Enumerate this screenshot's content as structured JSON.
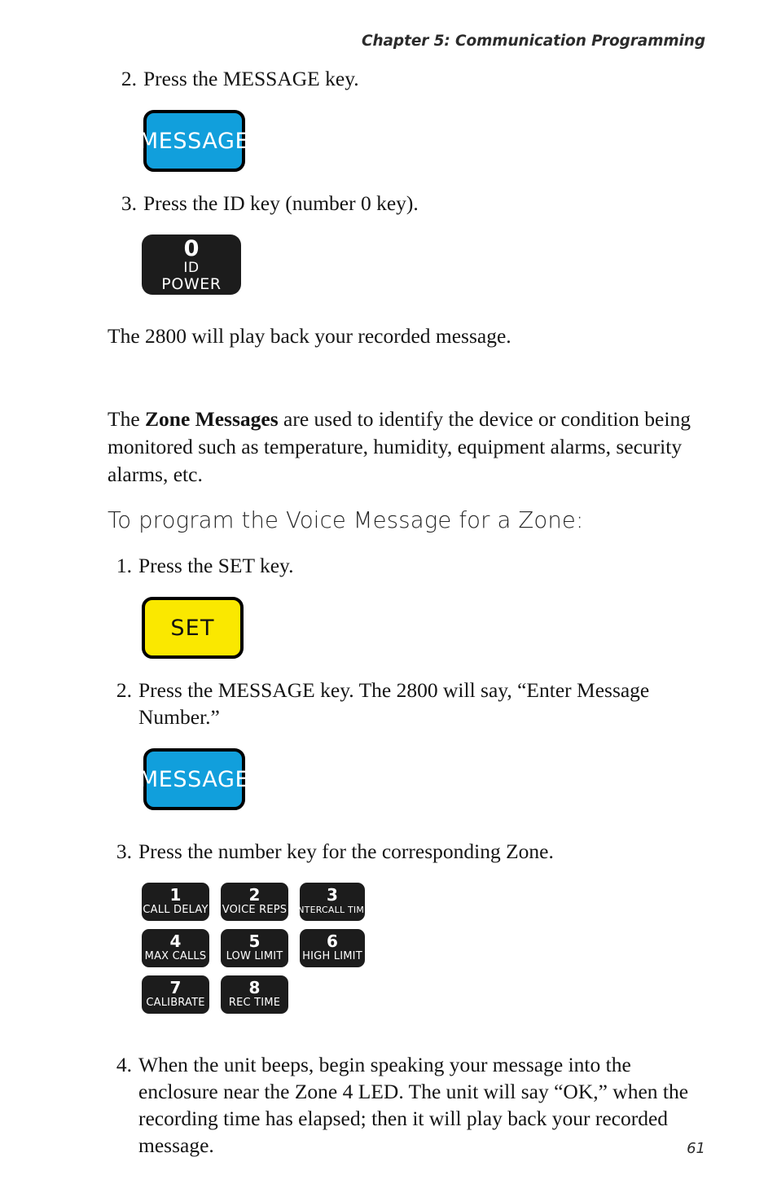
{
  "header": {
    "running_title": "Chapter 5: Communication Programming"
  },
  "footer": {
    "page_number": "61"
  },
  "colors": {
    "message_key_blue": "#119FDC",
    "set_key_yellow": "#FAE800",
    "number_key_black": "#1C1C1C",
    "key_border_black": "#000000",
    "body_text": "#141414"
  },
  "steps_top": [
    {
      "num": "2.",
      "text": "Press the MESSAGE key."
    },
    {
      "num": "3.",
      "text": "Press the ID key (number 0 key)."
    }
  ],
  "keys": {
    "message_1": {
      "label": "MESSAGE",
      "type": "function-key"
    },
    "message_2": {
      "label": "MESSAGE",
      "type": "function-key"
    },
    "set": {
      "label": "SET",
      "type": "function-key"
    },
    "zero": {
      "digit": "0",
      "line1": "ID",
      "line2": "POWER"
    }
  },
  "paragraphs": {
    "playback": "The 2800 will play back your recorded message.",
    "zone_messages_lead": "The ",
    "zone_messages_bold": "Zone Messages",
    "zone_messages_rest": " are used to identify the device or condition being monitored such as temperature, humidity, equipment alarms, security alarms, etc."
  },
  "section": {
    "heading": "To program the Voice Message for a Zone:"
  },
  "steps_bottom": [
    {
      "num": "1.",
      "text": "Press the SET key."
    },
    {
      "num": "2.",
      "text": "Press the MESSAGE key. The 2800 will say, “Enter Message Number.”"
    },
    {
      "num": "3.",
      "text": "Press the number key for the corresponding Zone."
    },
    {
      "num": "4.",
      "text": "When the unit beeps, begin speaking your message into the enclosure near the Zone 4 LED. The unit will say “OK,” when the recording time has elapsed; then it will play back your recorded message."
    }
  ],
  "keypad": {
    "rows": [
      [
        {
          "digit": "1",
          "label": "CALL DELAY"
        },
        {
          "digit": "2",
          "label": "VOICE REPS"
        },
        {
          "digit": "3",
          "label": "INTERCALL TIME"
        }
      ],
      [
        {
          "digit": "4",
          "label": "MAX CALLS"
        },
        {
          "digit": "5",
          "label": "LOW LIMIT"
        },
        {
          "digit": "6",
          "label": "HIGH LIMIT"
        }
      ],
      [
        {
          "digit": "7",
          "label": "CALIBRATE"
        },
        {
          "digit": "8",
          "label": "REC TIME"
        }
      ]
    ]
  }
}
